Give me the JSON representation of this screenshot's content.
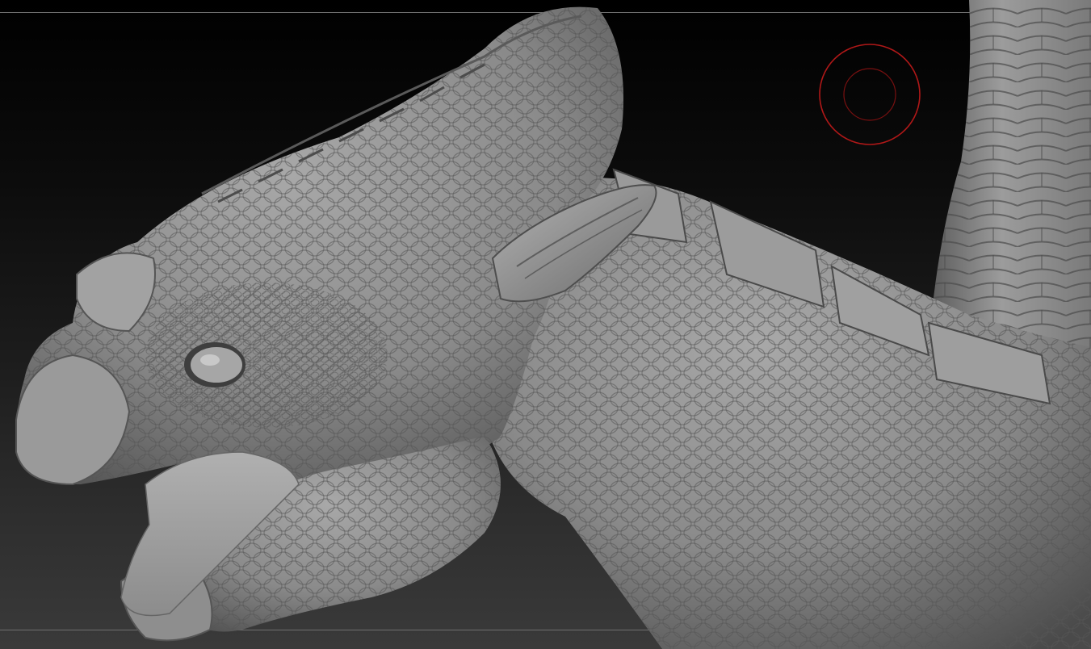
{
  "app": {
    "name": "",
    "view": "3d-viewport"
  },
  "viewport": {
    "background_top": "#000000",
    "background_bottom": "#3a3a3a",
    "frame_line_color": "#6f6f6f"
  },
  "model": {
    "subject": "sculpted-dragon-head-and-neck",
    "material_color": "#8a8a8a",
    "shadow_color": "#3c3c3c",
    "highlight_color": "#b8b8b8"
  },
  "brush_cursor": {
    "icon": "brush-draw-size-circle-icon",
    "color": "#b01818"
  }
}
